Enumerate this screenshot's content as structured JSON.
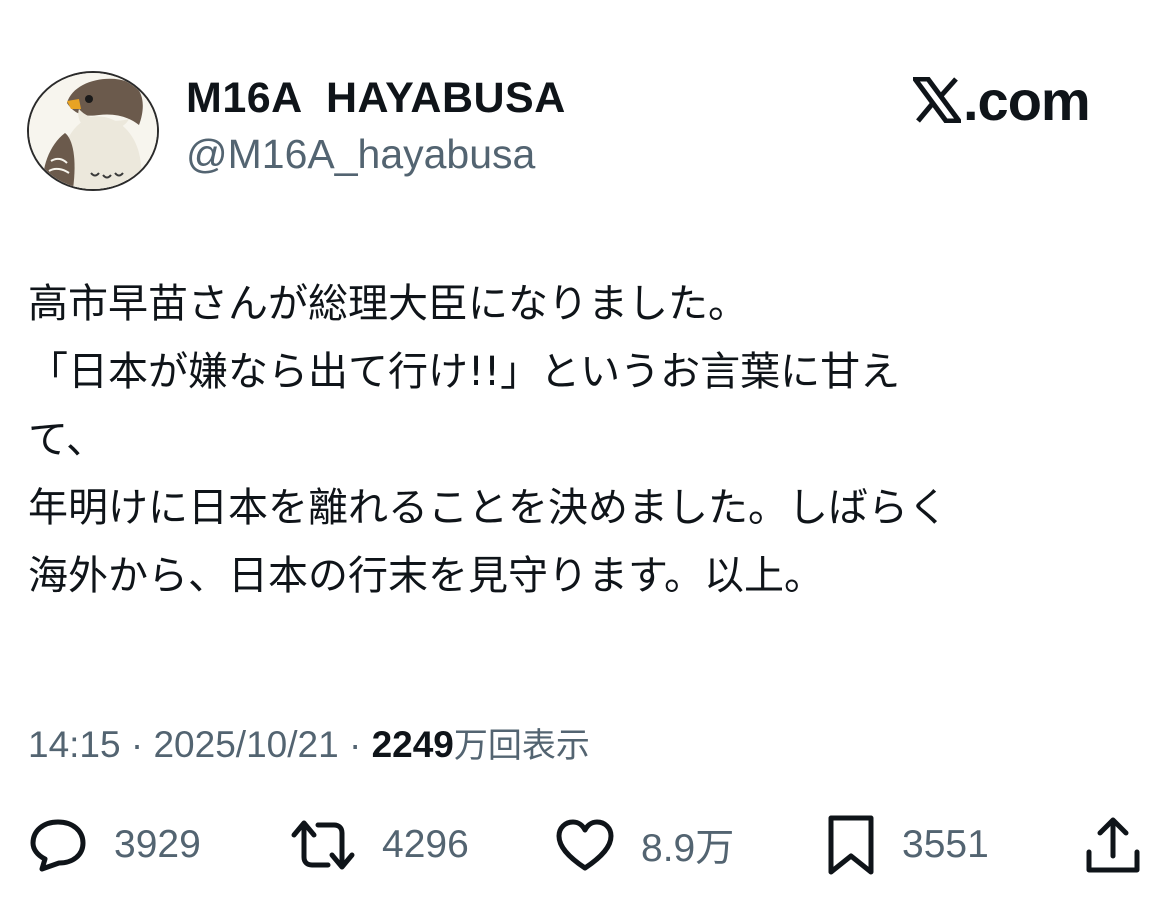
{
  "header": {
    "display_name": "M16A  HAYABUSA",
    "handle": "@M16A_hayabusa",
    "brand_icon": "x-logo-icon",
    "brand_text": ".com"
  },
  "tweet": {
    "lines": [
      "高市早苗さんが総理大臣になりました。",
      "「日本が嫌なら出て行け!!」というお言葉に甘え",
      "て、",
      "年明けに日本を離れることを決めました。しばらく",
      "海外から、日本の行末を見守ります。以上。"
    ]
  },
  "meta": {
    "time": "14:15",
    "separator": " · ",
    "date": "2025/10/21",
    "views_count": "2249",
    "views_unit_label": "万回表示"
  },
  "actions": {
    "reply": {
      "icon": "reply-icon",
      "count": "3929"
    },
    "retweet": {
      "icon": "retweet-icon",
      "count": "4296"
    },
    "like": {
      "icon": "heart-icon",
      "count": "8.9万"
    },
    "bookmark": {
      "icon": "bookmark-icon",
      "count": "3551"
    },
    "share": {
      "icon": "share-icon"
    }
  },
  "colors": {
    "text_primary": "#0f1419",
    "text_secondary": "#536471",
    "background": "#ffffff"
  }
}
